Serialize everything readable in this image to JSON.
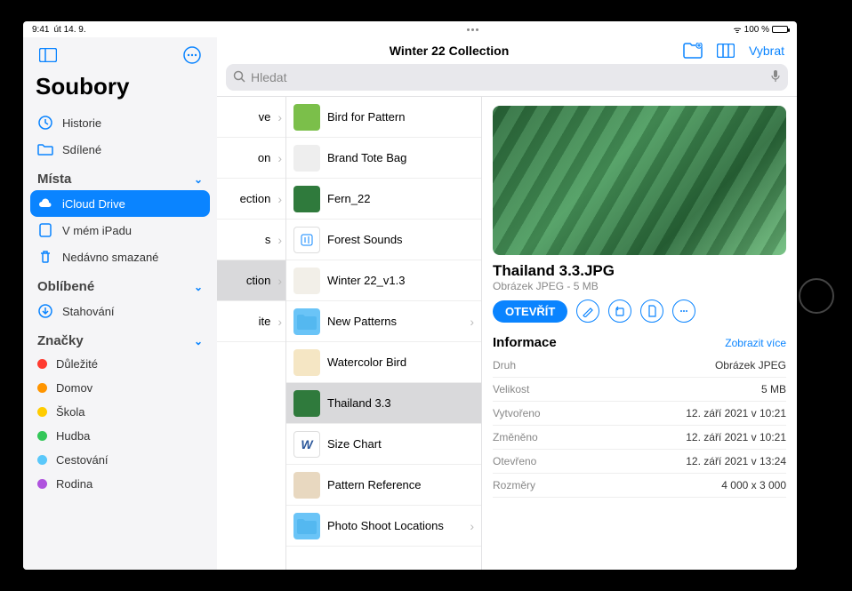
{
  "status": {
    "time": "9:41",
    "date": "út 14. 9.",
    "battery": "100 %",
    "wifi": "📶"
  },
  "sidebar": {
    "app_title": "Soubory",
    "top": [
      {
        "label": "Historie",
        "icon": "clock"
      },
      {
        "label": "Sdílené",
        "icon": "shared-folder"
      }
    ],
    "sections": [
      {
        "title": "Místa",
        "items": [
          {
            "label": "iCloud Drive",
            "icon": "cloud",
            "selected": true
          },
          {
            "label": "V mém iPadu",
            "icon": "ipad"
          },
          {
            "label": "Nedávno smazané",
            "icon": "trash"
          }
        ]
      },
      {
        "title": "Oblíbené",
        "items": [
          {
            "label": "Stahování",
            "icon": "download"
          }
        ]
      },
      {
        "title": "Značky",
        "items": [
          {
            "label": "Důležité",
            "color": "#ff3b30"
          },
          {
            "label": "Domov",
            "color": "#ff9500"
          },
          {
            "label": "Škola",
            "color": "#ffcc00"
          },
          {
            "label": "Hudba",
            "color": "#34c759"
          },
          {
            "label": "Cestování",
            "color": "#5ac8fa"
          },
          {
            "label": "Rodina",
            "color": "#af52de"
          }
        ]
      }
    ]
  },
  "toolbar": {
    "title": "Winter 22 Collection",
    "new_folder": "new-folder",
    "view_mode": "columns",
    "select_label": "Vybrat"
  },
  "search": {
    "placeholder": "Hledat"
  },
  "column1": [
    {
      "label": "ve"
    },
    {
      "label": "on"
    },
    {
      "label": "ection"
    },
    {
      "label": "s"
    },
    {
      "label": "ction",
      "selected": true
    },
    {
      "label": "ite"
    }
  ],
  "column2": [
    {
      "label": "Bird for Pattern",
      "thumb": "#7bbf4a"
    },
    {
      "label": "Brand Tote Bag",
      "thumb": "#eee"
    },
    {
      "label": "Fern_22",
      "thumb": "#2f7a3c"
    },
    {
      "label": "Forest Sounds",
      "thumb": "#fff",
      "icon": "audio"
    },
    {
      "label": "Winter 22_v1.3",
      "thumb": "#f2efe8"
    },
    {
      "label": "New Patterns",
      "thumb": "folder",
      "folder": true,
      "hasChildren": true
    },
    {
      "label": "Watercolor Bird",
      "thumb": "#f5e6c4"
    },
    {
      "label": "Thailand 3.3",
      "thumb": "#2f7a3c",
      "selected": true
    },
    {
      "label": "Size Chart",
      "thumb": "#fff",
      "icon": "W"
    },
    {
      "label": "Pattern Reference",
      "thumb": "#e8d8c0"
    },
    {
      "label": "Photo Shoot Locations",
      "thumb": "folder",
      "folder": true,
      "hasChildren": true
    }
  ],
  "detail": {
    "title": "Thailand 3.3.JPG",
    "subtitle": "Obrázek JPEG - 5 MB",
    "open_label": "OTEVŘÍT",
    "info_title": "Informace",
    "show_more": "Zobrazit více",
    "rows": [
      {
        "k": "Druh",
        "v": "Obrázek JPEG"
      },
      {
        "k": "Velikost",
        "v": "5 MB"
      },
      {
        "k": "Vytvořeno",
        "v": "12. září 2021 v 10:21"
      },
      {
        "k": "Změněno",
        "v": "12. září 2021 v 10:21"
      },
      {
        "k": "Otevřeno",
        "v": "12. září 2021 v 13:24"
      },
      {
        "k": "Rozměry",
        "v": "4 000 x 3 000"
      }
    ]
  }
}
